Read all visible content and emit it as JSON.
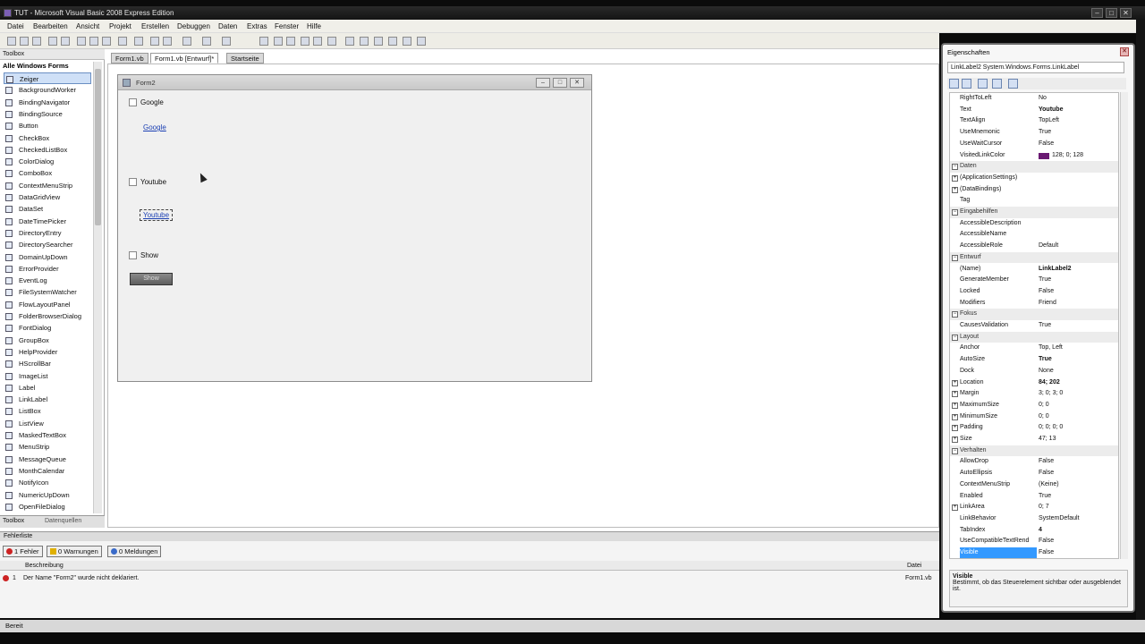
{
  "window": {
    "title": "TUT - Microsoft Visual Basic 2008 Express Edition",
    "min": "–",
    "max": "□",
    "close": "✕"
  },
  "menu": [
    "Datei",
    "Bearbeiten",
    "Ansicht",
    "Projekt",
    "Erstellen",
    "Debuggen",
    "Daten",
    "Extras",
    "Fenster",
    "Hilfe"
  ],
  "toolbox": {
    "title": "Toolbox",
    "group": "Alle Windows Forms",
    "items": [
      "Zeiger",
      "BackgroundWorker",
      "BindingNavigator",
      "BindingSource",
      "Button",
      "CheckBox",
      "CheckedListBox",
      "ColorDialog",
      "ComboBox",
      "ContextMenuStrip",
      "DataGridView",
      "DataSet",
      "DateTimePicker",
      "DirectoryEntry",
      "DirectorySearcher",
      "DomainUpDown",
      "ErrorProvider",
      "EventLog",
      "FileSystemWatcher",
      "FlowLayoutPanel",
      "FolderBrowserDialog",
      "FontDialog",
      "GroupBox",
      "HelpProvider",
      "HScrollBar",
      "ImageList",
      "Label",
      "LinkLabel",
      "ListBox",
      "ListView",
      "MaskedTextBox",
      "MenuStrip",
      "MessageQueue",
      "MonthCalendar",
      "NotifyIcon",
      "NumericUpDown",
      "OpenFileDialog"
    ],
    "bottom_tabs": [
      "Toolbox",
      "Datenquellen"
    ]
  },
  "doc_tabs": [
    "Form1.vb",
    "Form1.vb [Entwurf]*",
    "Startseite"
  ],
  "form": {
    "title": "Form2",
    "checkbox1": "Google",
    "link1": "Google",
    "checkbox2": "Youtube",
    "link2": "Youtube",
    "checkbox3": "Show",
    "button": "Show"
  },
  "properties": {
    "title": "Eigenschaften",
    "object": "LinkLabel2  System.Windows.Forms.LinkLabel",
    "rows": [
      {
        "n": "RightToLeft",
        "v": "No"
      },
      {
        "n": "Text",
        "v": "Youtube",
        "bold": true
      },
      {
        "n": "TextAlign",
        "v": "TopLeft"
      },
      {
        "n": "UseMnemonic",
        "v": "True"
      },
      {
        "n": "UseWaitCursor",
        "v": "False"
      },
      {
        "n": "VisitedLinkColor",
        "v": "128; 0; 128",
        "swatch": true
      },
      {
        "n": "Daten",
        "cat": true
      },
      {
        "n": "(ApplicationSettings)",
        "ex": true
      },
      {
        "n": "(DataBindings)",
        "ex": true
      },
      {
        "n": "Tag",
        "v": ""
      },
      {
        "n": "Eingabehilfen",
        "cat": true
      },
      {
        "n": "AccessibleDescription",
        "v": ""
      },
      {
        "n": "AccessibleName",
        "v": ""
      },
      {
        "n": "AccessibleRole",
        "v": "Default"
      },
      {
        "n": "Entwurf",
        "cat": true
      },
      {
        "n": "(Name)",
        "v": "LinkLabel2",
        "bold": true
      },
      {
        "n": "GenerateMember",
        "v": "True"
      },
      {
        "n": "Locked",
        "v": "False"
      },
      {
        "n": "Modifiers",
        "v": "Friend"
      },
      {
        "n": "Fokus",
        "cat": true
      },
      {
        "n": "CausesValidation",
        "v": "True"
      },
      {
        "n": "Layout",
        "cat": true
      },
      {
        "n": "Anchor",
        "v": "Top, Left"
      },
      {
        "n": "AutoSize",
        "v": "True",
        "bold": true
      },
      {
        "n": "Dock",
        "v": "None"
      },
      {
        "n": "Location",
        "v": "84; 202",
        "ex": true,
        "bold": true
      },
      {
        "n": "Margin",
        "v": "3; 0; 3; 0",
        "ex": true
      },
      {
        "n": "MaximumSize",
        "v": "0; 0",
        "ex": true
      },
      {
        "n": "MinimumSize",
        "v": "0; 0",
        "ex": true
      },
      {
        "n": "Padding",
        "v": "0; 0; 0; 0",
        "ex": true
      },
      {
        "n": "Size",
        "v": "47; 13",
        "ex": true
      },
      {
        "n": "Verhalten",
        "cat": true
      },
      {
        "n": "AllowDrop",
        "v": "False"
      },
      {
        "n": "AutoEllipsis",
        "v": "False"
      },
      {
        "n": "ContextMenuStrip",
        "v": "(Keine)"
      },
      {
        "n": "Enabled",
        "v": "True"
      },
      {
        "n": "LinkArea",
        "v": "0; 7",
        "ex": true
      },
      {
        "n": "LinkBehavior",
        "v": "SystemDefault"
      },
      {
        "n": "TabIndex",
        "v": "4",
        "bold": true
      },
      {
        "n": "UseCompatibleTextRend",
        "v": "False"
      },
      {
        "n": "Visible",
        "v": "False",
        "sel": true
      }
    ],
    "desc_title": "Visible",
    "desc_text": "Bestimmt, ob das Steuerelement sichtbar oder ausgeblendet ist."
  },
  "errorlist": {
    "title": "Fehlerliste",
    "btn_errors": "1 Fehler",
    "btn_warnings": "0 Warnungen",
    "btn_messages": "0 Meldungen",
    "col_desc": "Beschreibung",
    "col_file": "Datei",
    "row_num": "1",
    "row_desc": "Der Name \"Form2\" wurde nicht deklariert.",
    "row_file": "Form1.vb"
  },
  "status": "Bereit",
  "colors": {
    "link": "#1a3fb3",
    "selection": "#3399ff",
    "visited": "#800080"
  }
}
